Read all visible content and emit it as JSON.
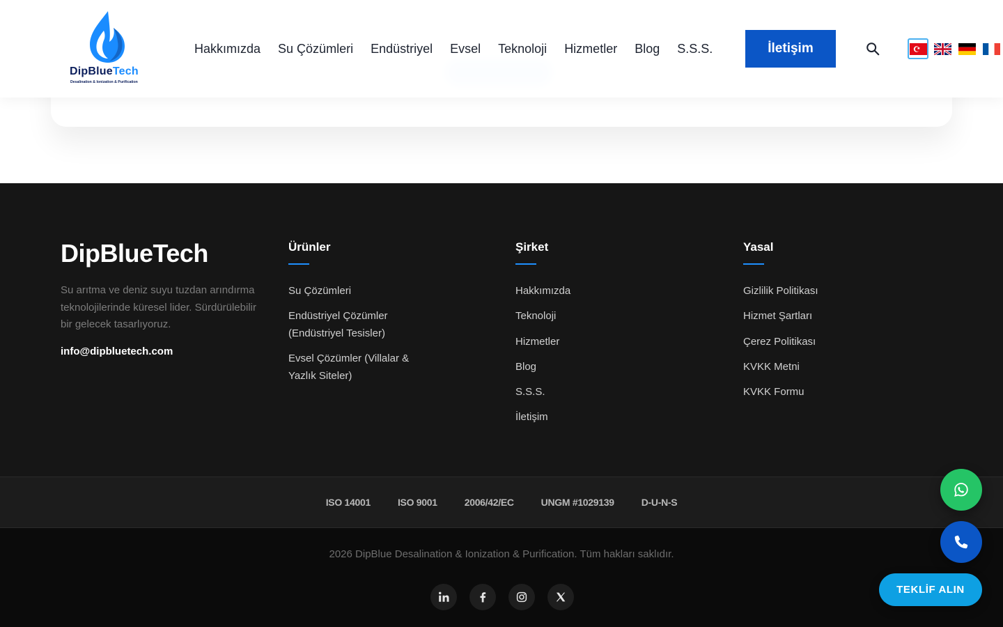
{
  "header": {
    "logo": {
      "name_part1": "DipBlue",
      "name_part2": "Tech",
      "tagline": "Desalination & Ionization & Purification"
    },
    "nav": [
      "Hakkımızda",
      "Su Çözümleri",
      "Endüstriyel",
      "Evsel",
      "Teknoloji",
      "Hizmetler",
      "Blog",
      "S.S.S."
    ],
    "cta_label": "İletişim",
    "languages": [
      {
        "code": "tr",
        "icon": "turkey-flag-icon",
        "active": true
      },
      {
        "code": "en",
        "icon": "uk-flag-icon",
        "active": false
      },
      {
        "code": "de",
        "icon": "germany-flag-icon",
        "active": false
      },
      {
        "code": "fr",
        "icon": "france-flag-icon",
        "active": false
      }
    ]
  },
  "footer": {
    "brand": "DipBlueTech",
    "about": "Su arıtma ve deniz suyu tuzdan arındırma teknolojilerinde küresel lider. Sürdürülebilir bir gelecek tasarlıyoruz.",
    "email": "info@dipbluetech.com",
    "columns": [
      {
        "title": "Ürünler",
        "links": [
          "Su Çözümleri",
          "Endüstriyel Çözümler (Endüstriyel Tesisler)",
          "Evsel Çözümler (Villalar & Yazlık Siteler)"
        ]
      },
      {
        "title": "Şirket",
        "links": [
          "Hakkımızda",
          "Teknoloji",
          "Hizmetler",
          "Blog",
          "S.S.S.",
          "İletişim"
        ]
      },
      {
        "title": "Yasal",
        "links": [
          "Gizlilik Politikası",
          "Hizmet Şartları",
          "Çerez Politikası",
          "KVKK Metni",
          "KVKK Formu"
        ]
      }
    ],
    "certifications": [
      "ISO 14001",
      "ISO 9001",
      "2006/42/EC",
      "UNGM #1029139",
      "D-U-N-S"
    ],
    "copyright": "2026 DipBlue Desalination & Ionization & Purification. Tüm hakları saklıdır.",
    "social": [
      "linkedin-icon",
      "facebook-icon",
      "instagram-icon",
      "x-icon"
    ]
  },
  "floating": {
    "whatsapp_icon": "whatsapp-icon",
    "phone_icon": "phone-icon",
    "quote_label": "TEKLİF ALIN"
  },
  "colors": {
    "primary": "#0b56c6",
    "accent": "#1e90ff",
    "whatsapp": "#25c466",
    "quote": "#0ea0e3",
    "footer_bg": "#161616"
  }
}
